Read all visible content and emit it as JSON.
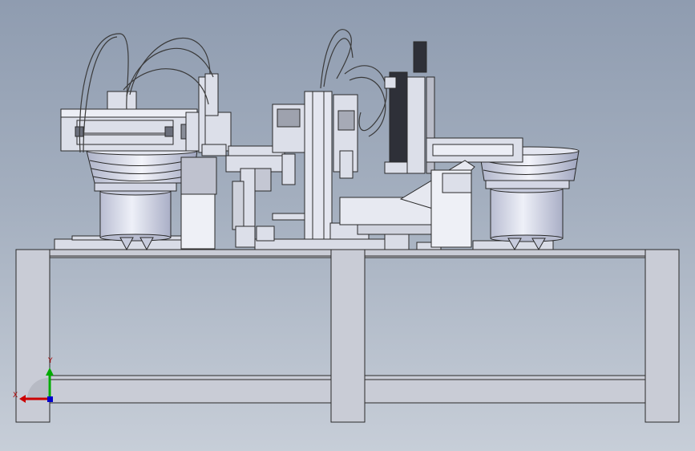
{
  "viewport": {
    "background_top": "#8f9cb0",
    "background_bottom": "#c7ced8"
  },
  "model": {
    "edge_color": "#2a2a2a",
    "frame_fill": "#c9ccd6",
    "metal_fill": "#d9dce6",
    "bowl_fill": "#cfd3e6"
  },
  "triad": {
    "x_label": "X",
    "y_label": "Y",
    "x_color": "#cc0000",
    "y_color": "#00aa00",
    "z_color": "#0000cc"
  }
}
